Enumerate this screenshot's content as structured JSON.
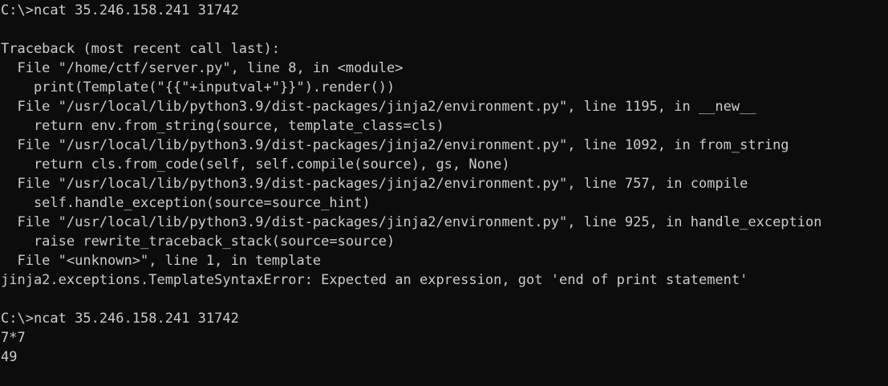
{
  "terminal": {
    "background": "#0c0c0c",
    "foreground": "#cccccc",
    "lines": [
      "C:\\>ncat 35.246.158.241 31742",
      "",
      "Traceback (most recent call last):",
      "  File \"/home/ctf/server.py\", line 8, in <module>",
      "    print(Template(\"{{\"+inputval+\"}}\").render())",
      "  File \"/usr/local/lib/python3.9/dist-packages/jinja2/environment.py\", line 1195, in __new__",
      "    return env.from_string(source, template_class=cls)",
      "  File \"/usr/local/lib/python3.9/dist-packages/jinja2/environment.py\", line 1092, in from_string",
      "    return cls.from_code(self, self.compile(source), gs, None)",
      "  File \"/usr/local/lib/python3.9/dist-packages/jinja2/environment.py\", line 757, in compile",
      "    self.handle_exception(source=source_hint)",
      "  File \"/usr/local/lib/python3.9/dist-packages/jinja2/environment.py\", line 925, in handle_exception",
      "    raise rewrite_traceback_stack(source=source)",
      "  File \"<unknown>\", line 1, in template",
      "jinja2.exceptions.TemplateSyntaxError: Expected an expression, got 'end of print statement'",
      "",
      "C:\\>ncat 35.246.158.241 31742",
      "7*7",
      "49"
    ]
  }
}
